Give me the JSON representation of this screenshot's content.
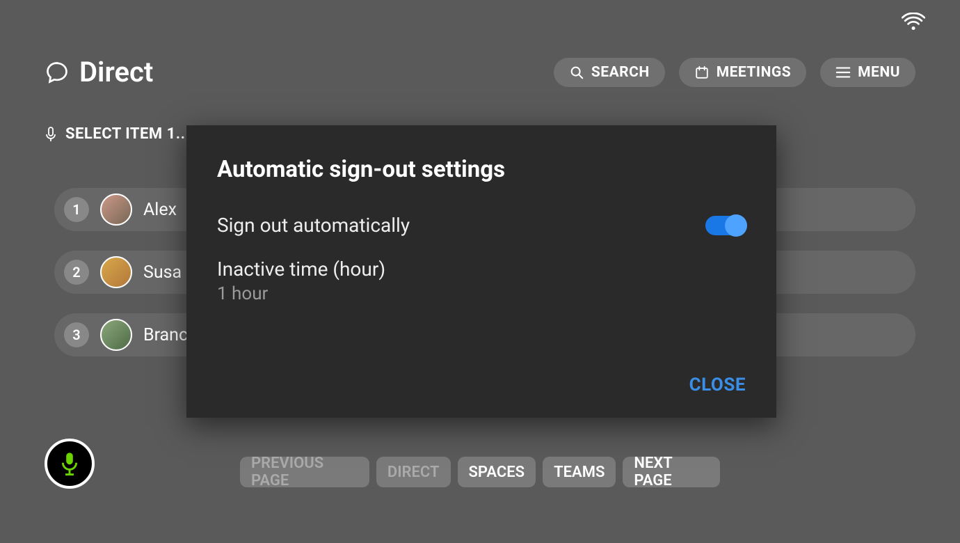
{
  "status": {
    "wifi": true
  },
  "header": {
    "title": "Direct",
    "search_label": "SEARCH",
    "meetings_label": "MEETINGS",
    "menu_label": "MENU"
  },
  "select_hint": "SELECT ITEM 1..",
  "list": {
    "items": [
      {
        "index": "1",
        "name": "Alex"
      },
      {
        "index": "2",
        "name": "Susa"
      },
      {
        "index": "3",
        "name": "Branc"
      }
    ]
  },
  "footer": {
    "prev": "PREVIOUS PAGE",
    "direct": "DIRECT",
    "spaces": "SPACES",
    "teams": "TEAMS",
    "next": "NEXT PAGE"
  },
  "modal": {
    "title": "Automatic sign-out settings",
    "signout_label": "Sign out automatically",
    "signout_enabled": true,
    "inactive_label": "Inactive time (hour)",
    "inactive_value": "1 hour",
    "close_label": "CLOSE"
  }
}
